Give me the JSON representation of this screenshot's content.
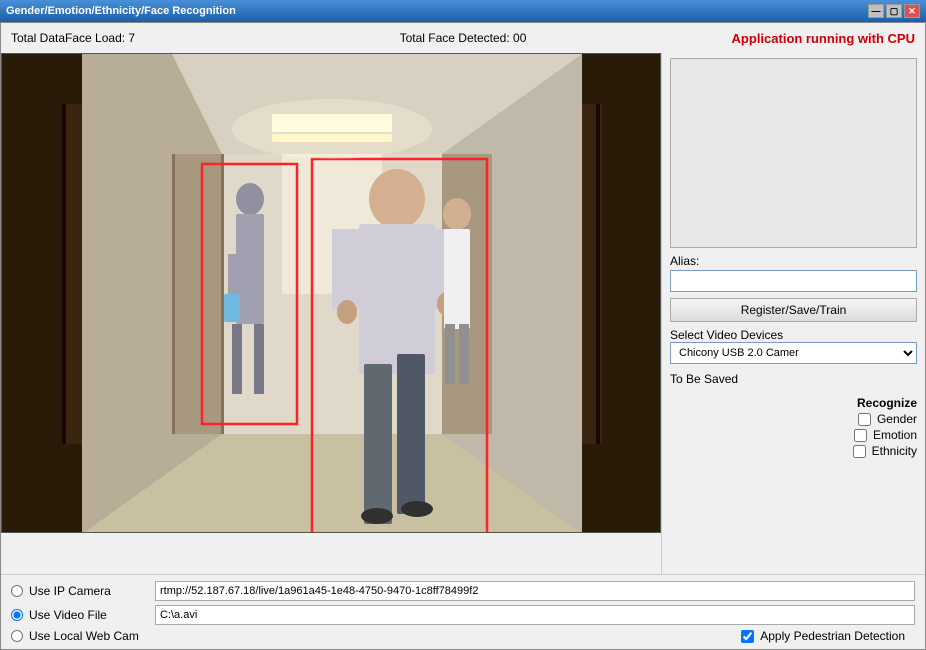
{
  "window": {
    "title": "Gender/Emotion/Ethnicity/Face Recognition",
    "title_buttons": [
      "minimize",
      "maximize",
      "close"
    ]
  },
  "stats": {
    "dataface_load_label": "Total DataFace Load:",
    "dataface_load_value": "7",
    "face_detected_label": "Total Face Detected:",
    "face_detected_value": "00",
    "status_text": "Application running with CPU"
  },
  "side_panel": {
    "alias_label": "Alias:",
    "alias_placeholder": "",
    "register_button": "Register/Save/Train",
    "select_video_label": "Select Video Devices",
    "video_device_selected": "Chicony USB 2.0 Camer",
    "video_device_options": [
      "Chicony USB 2.0 Camer"
    ],
    "to_be_saved_label": "To Be Saved",
    "recognize_title": "Recognize",
    "checkboxes": [
      {
        "id": "gender",
        "label": "Gender",
        "checked": false
      },
      {
        "id": "emotion",
        "label": "Emotion",
        "checked": false
      },
      {
        "id": "ethnicity",
        "label": "Ethnicity",
        "checked": false
      }
    ]
  },
  "bottom": {
    "radio_options": [
      {
        "id": "ip_camera",
        "label": "Use IP Camera",
        "value": "ip_camera",
        "checked": false
      },
      {
        "id": "video_file",
        "label": "Use Video File",
        "value": "video_file",
        "checked": true
      },
      {
        "id": "local_webcam",
        "label": "Use Local Web Cam",
        "value": "local_webcam",
        "checked": false
      }
    ],
    "ip_camera_url": "rtmp://52.187.67.18/live/1a961a45-1e48-4750-9470-1c8ff78499f2",
    "video_file_path": "C:\\a.avi",
    "pedestrian_checkbox_label": "Apply Pedestrian Detection",
    "pedestrian_checked": true
  }
}
